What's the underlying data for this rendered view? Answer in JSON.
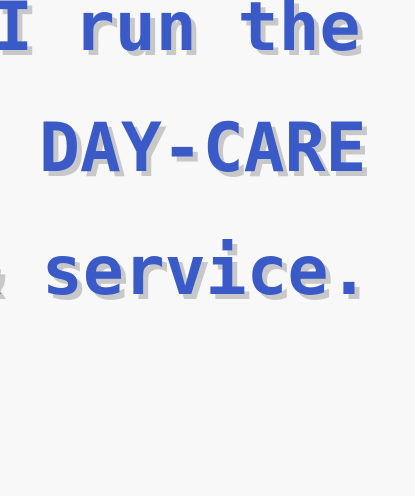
{
  "dialogue": {
    "lines": [
      "I run the",
      " DAY-CARE",
      "& service."
    ]
  },
  "colors": {
    "background": "#f8f8f8",
    "text": "#3a5ac8",
    "text_shadow": "#c8c8c8"
  }
}
